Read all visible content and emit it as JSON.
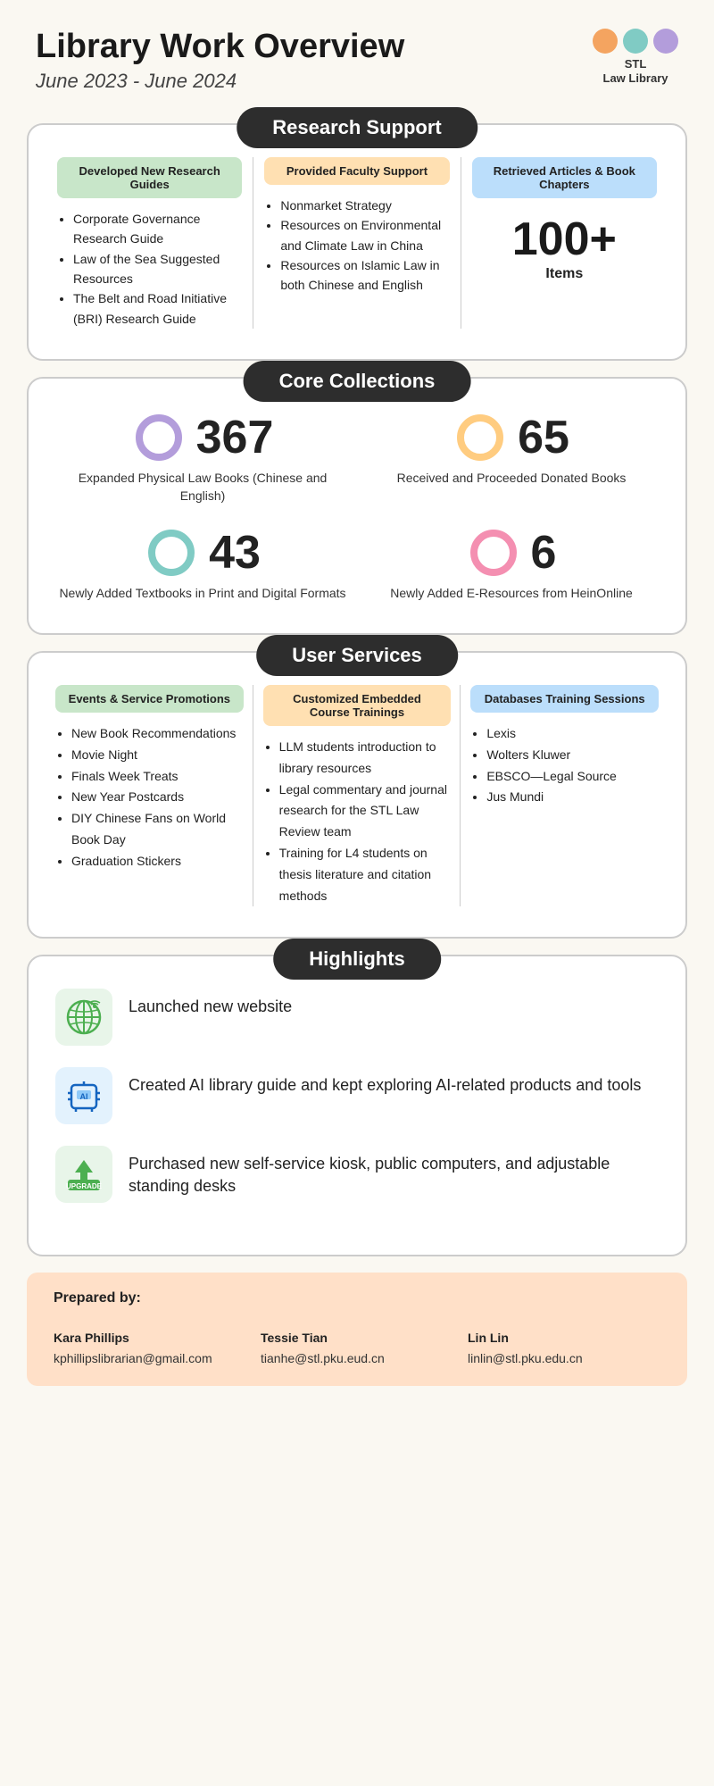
{
  "header": {
    "title": "Library Work Overview",
    "subtitle": "June 2023 - June 2024",
    "logo_text": "STL\nLaw Library",
    "logo_colors": [
      "#f4a460",
      "#80cbc4",
      "#b39ddb"
    ]
  },
  "research_support": {
    "section_title": "Research Support",
    "col1": {
      "label": "Developed New Research Guides",
      "items": [
        "Corporate Governance Research Guide",
        "Law of the Sea Suggested Resources",
        "The Belt and Road Initiative (BRI) Research Guide"
      ]
    },
    "col2": {
      "label": "Provided Faculty Support",
      "items": [
        "Nonmarket Strategy",
        "Resources on Environmental and Climate Law in China",
        "Resources on Islamic Law in both Chinese and English"
      ]
    },
    "col3": {
      "label": "Retrieved Articles & Book Chapters",
      "big_number": "100+",
      "big_label": "Items"
    }
  },
  "core_collections": {
    "section_title": "Core Collections",
    "items": [
      {
        "number": "367",
        "label": "Expanded Physical Law Books (Chinese and English)",
        "ring_class": "ring-purple"
      },
      {
        "number": "65",
        "label": "Received and Proceeded Donated Books",
        "ring_class": "ring-orange"
      },
      {
        "number": "43",
        "label": "Newly Added Textbooks in Print and Digital Formats",
        "ring_class": "ring-green"
      },
      {
        "number": "6",
        "label": "Newly Added E-Resources from HeinOnline",
        "ring_class": "ring-pink"
      }
    ]
  },
  "user_services": {
    "section_title": "User Services",
    "col1": {
      "label": "Events & Service Promotions",
      "items": [
        "New Book Recommendations",
        "Movie Night",
        "Finals Week Treats",
        "New Year Postcards",
        "DIY Chinese Fans on World Book Day",
        "Graduation Stickers"
      ]
    },
    "col2": {
      "label": "Customized Embedded Course Trainings",
      "items": [
        "LLM students introduction to library resources",
        "Legal commentary and journal research for the STL Law Review team",
        "Training for L4 students on thesis literature and citation methods"
      ]
    },
    "col3": {
      "label": "Databases Training Sessions",
      "items": [
        "Lexis",
        "Wolters Kluwer",
        "EBSCO—Legal Source",
        "Jus Mundi"
      ]
    }
  },
  "highlights": {
    "section_title": "Highlights",
    "items": [
      {
        "text": "Launched new website",
        "icon_type": "globe"
      },
      {
        "text": "Created AI library guide and kept exploring AI-related products and tools",
        "icon_type": "ai"
      },
      {
        "text": "Purchased new self-service kiosk, public computers, and adjustable standing desks",
        "icon_type": "upgrade"
      }
    ]
  },
  "footer": {
    "prepared_label": "Prepared by:",
    "people": [
      {
        "name": "Kara Phillips",
        "email": "kphillipslibrarian@gmail.com"
      },
      {
        "name": "Tessie Tian",
        "email": "tianhe@stl.pku.eud.cn"
      },
      {
        "name": "Lin Lin",
        "email": "linlin@stl.pku.edu.cn"
      }
    ]
  }
}
